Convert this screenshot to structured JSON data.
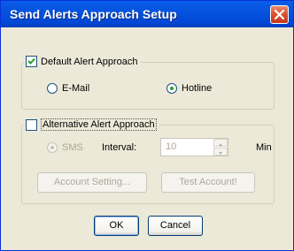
{
  "window": {
    "title": "Send Alerts Approach Setup"
  },
  "default_group": {
    "label": "Default Alert Approach",
    "checked": true,
    "options": [
      {
        "label": "E-Mail",
        "selected": false
      },
      {
        "label": "Hotline",
        "selected": true
      }
    ]
  },
  "alternative_group": {
    "label": "Alternative Alert Approach",
    "checked": false,
    "sms_label": "SMS",
    "sms_selected": true,
    "interval_label": "Interval:",
    "interval_value": "10",
    "interval_unit": "Min",
    "account_setting_label": "Account Setting...",
    "test_account_label": "Test Account!"
  },
  "buttons": {
    "ok": "OK",
    "cancel": "Cancel"
  },
  "colors": {
    "titlebar": "#0553e0",
    "close": "#d9502f",
    "dialog_bg": "#ece9d8"
  },
  "icons": {
    "close": "close-icon",
    "check": "checkmark-icon"
  }
}
